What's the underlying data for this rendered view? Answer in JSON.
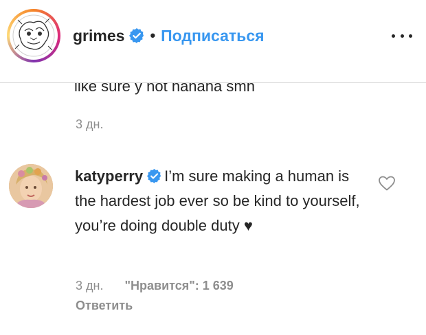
{
  "header": {
    "username": "grimes",
    "separator": "•",
    "follow_label": "Подписаться"
  },
  "comments": {
    "previous": {
      "text": "like sure y not hahaha smh",
      "time": "3 дн."
    },
    "current": {
      "username": "katyperry",
      "text": "I’m sure making a human is the hardest job ever so be kind to yourself, you’re doing double duty ♥",
      "time": "3 дн.",
      "likes": "\"Нравится\": 1 639",
      "reply_label": "Ответить"
    }
  },
  "icons": {
    "verified": "verified-badge-icon",
    "like": "heart-outline-icon",
    "more": "more-horizontal-icon"
  },
  "colors": {
    "link": "#3897f0",
    "verified": "#3897f0",
    "secondary_text": "#8e8e8e",
    "primary_text": "#262626",
    "divider": "#dbdbdb"
  }
}
